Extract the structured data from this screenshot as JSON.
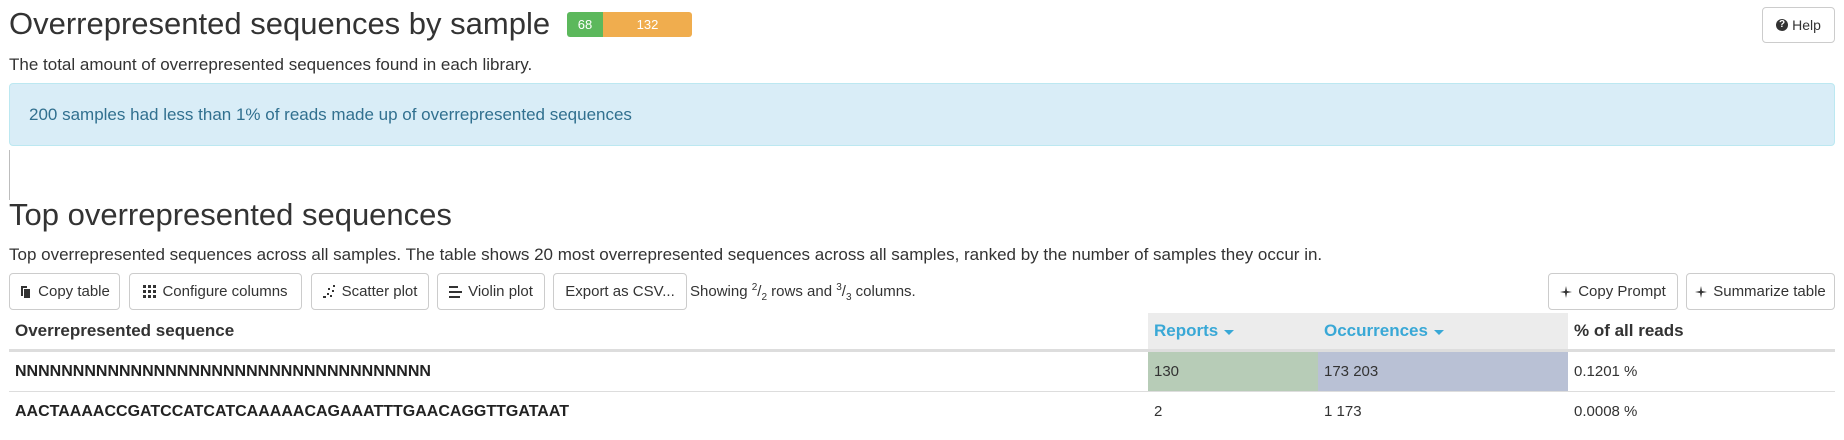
{
  "section1": {
    "title": "Overrepresented sequences by sample",
    "status": {
      "pass": "68",
      "warn": "132",
      "pass_color": "#5cb85c",
      "warn_color": "#f0ad4e"
    },
    "help_label": "Help",
    "description": "The total amount of overrepresented sequences found in each library.",
    "alert": "200 samples had less than 1% of reads made up of overrepresented sequences",
    "alert_color": "#d9edf7"
  },
  "section2": {
    "title": "Top overrepresented sequences",
    "description": "Top overrepresented sequences across all samples. The table shows 20 most overrepresented sequences across all samples, ranked by the number of samples they occur in.",
    "toolbar": {
      "copy_table": "Copy table",
      "configure_columns": "Configure columns",
      "scatter_plot": "Scatter plot",
      "violin_plot": "Violin plot",
      "export_csv": "Export as CSV...",
      "copy_prompt": "Copy Prompt",
      "summarize_table": "Summarize table"
    },
    "showing": {
      "prefix": "Showing ",
      "rows_num": "2",
      "rows_den": "2",
      "middle": " rows and ",
      "cols_num": "3",
      "cols_den": "3",
      "suffix": " columns."
    }
  },
  "table": {
    "headers": {
      "sequence": "Overrepresented sequence",
      "reports": "Reports",
      "occurrences": "Occurrences",
      "pct": "% of all reads"
    },
    "rows": [
      {
        "sequence": "NNNNNNNNNNNNNNNNNNNNNNNNNNNNNNNNNNNN",
        "reports": "130",
        "occurrences": "173 203",
        "pct": "0.1201 %"
      },
      {
        "sequence": "AACTAAAACCGATCCATCATCAAAAACAGAAATTTGAACAGGTTGATAAT",
        "reports": "2",
        "occurrences": "1 173",
        "pct": "0.0008 %"
      }
    ],
    "reports_bar_color": "#b7ccb7",
    "occurrences_bar_color": "#b9c1d5",
    "sort_header_color": "#39a8d6"
  }
}
